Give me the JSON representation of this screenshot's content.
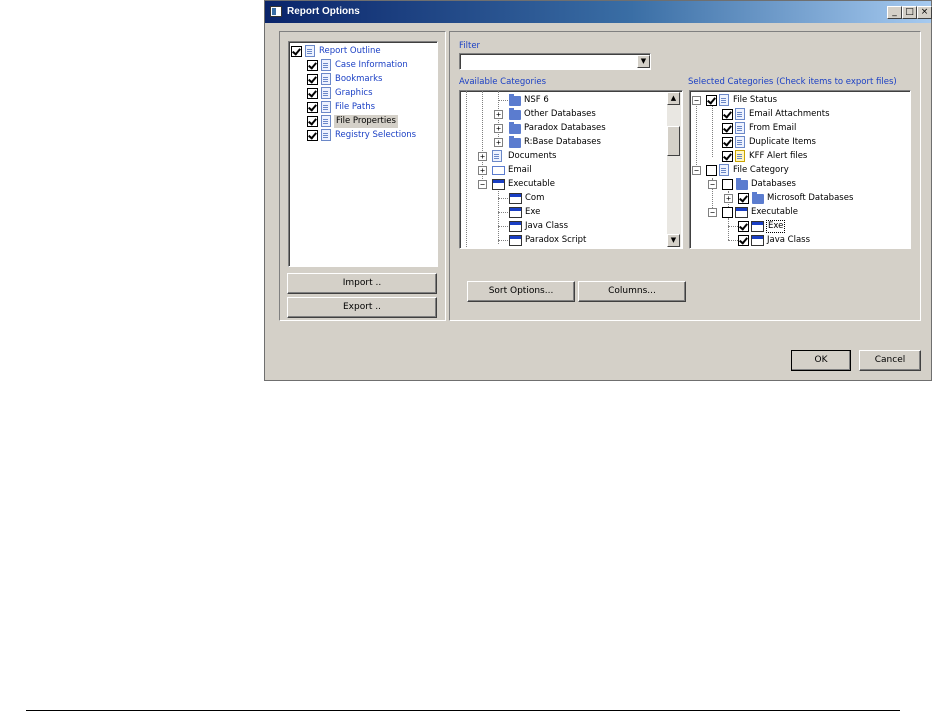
{
  "window": {
    "title": "Report Options",
    "buttons": {
      "minimize": "_",
      "maximize": "□",
      "close": "×"
    }
  },
  "outline": {
    "items": [
      {
        "label": "Report Outline",
        "checked": true
      },
      {
        "label": "Case Information",
        "checked": true
      },
      {
        "label": "Bookmarks",
        "checked": true
      },
      {
        "label": "Graphics",
        "checked": true
      },
      {
        "label": "File Paths",
        "checked": true
      },
      {
        "label": "File Properties",
        "checked": true
      },
      {
        "label": "Registry Selections",
        "checked": true
      }
    ],
    "import_label": "Import ..",
    "export_label": "Export .."
  },
  "filter": {
    "label": "Filter",
    "value": ""
  },
  "available": {
    "label": "Available Categories",
    "items": [
      "NSF 6",
      "Other Databases",
      "Paradox Databases",
      "R:Base Databases",
      "Documents",
      "Email",
      "Executable",
      "Com",
      "Exe",
      "Java Class",
      "Paradox Script"
    ]
  },
  "selected": {
    "label": "Selected Categories (Check items to export files)",
    "items": [
      "File Status",
      "Email Attachments",
      "From Email",
      "Duplicate Items",
      "KFF Alert files",
      "File Category",
      "Databases",
      "Microsoft Databases",
      "Executable",
      "Exe",
      "Java Class"
    ]
  },
  "buttons": {
    "sort_options": "Sort Options...",
    "columns": "Columns...",
    "ok": "OK",
    "cancel": "Cancel"
  },
  "colors": {
    "title_start": "#0a246a",
    "title_end": "#a6caf0",
    "label_blue": "#1a3fc4",
    "dialog_bg": "#d4d0c8"
  }
}
